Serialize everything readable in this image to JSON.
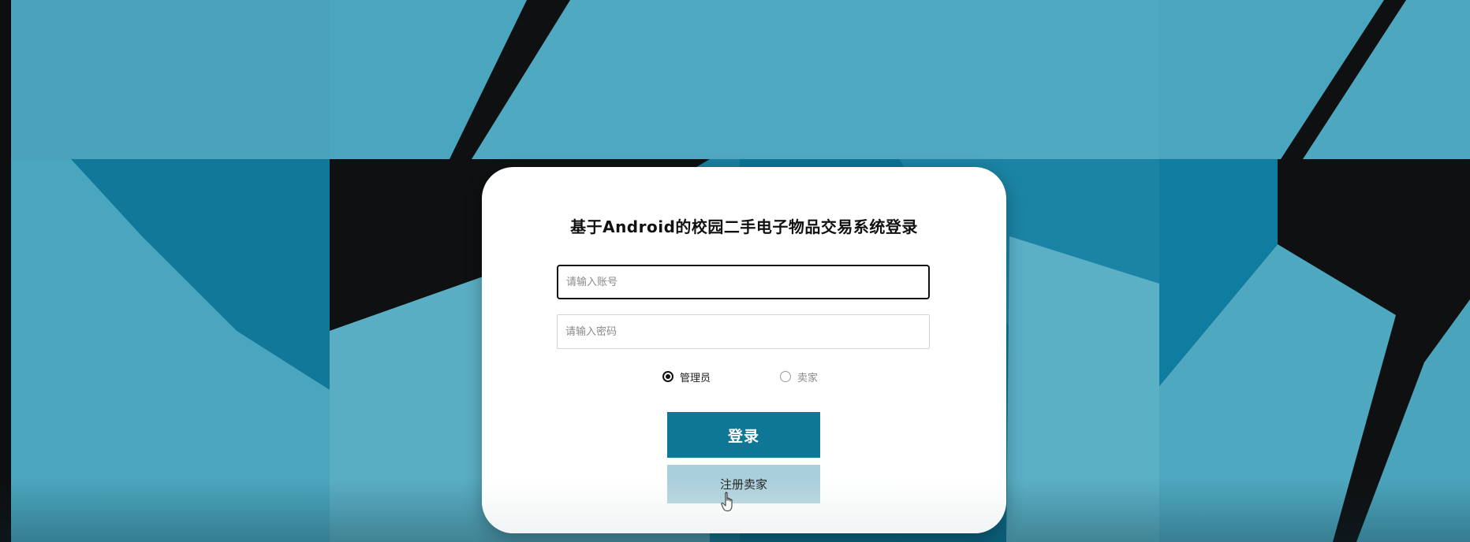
{
  "login": {
    "title": "基于Android的校园二手电子物品交易系统登录",
    "account_placeholder": "请输入账号",
    "password_placeholder": "请输入密码",
    "roles": [
      {
        "label": "管理员",
        "selected": true
      },
      {
        "label": "卖家",
        "selected": false
      }
    ],
    "login_label": "登录",
    "register_label": "注册卖家"
  },
  "colors": {
    "background_teal": "#4fa8c0",
    "background_dark": "#0f1011",
    "card": "#ffffff",
    "login_button": "#0f7796",
    "register_button": "#a9cfdb"
  },
  "icons": {
    "pointer_cursor": "hand-pointer-icon"
  }
}
